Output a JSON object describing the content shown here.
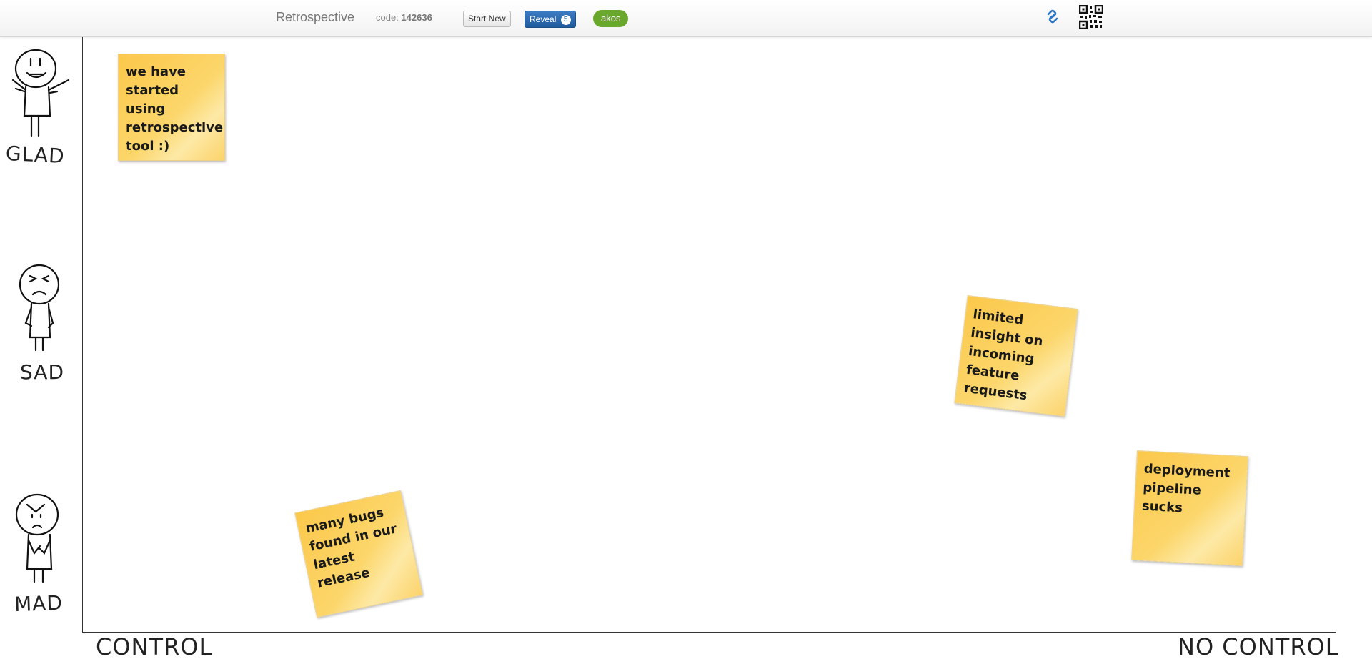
{
  "header": {
    "app_title": "Retrospective",
    "code_label": "code:",
    "code_value": "142636",
    "start_new_label": "Start New",
    "reveal_label": "Reveal",
    "reveal_count": "5",
    "user_name": "akos"
  },
  "board": {
    "emotions": [
      {
        "label": "GLAD"
      },
      {
        "label": "SAD"
      },
      {
        "label": "MAD"
      }
    ],
    "x_axis": {
      "left_label": "CONTROL",
      "right_label": "NO CONTROL"
    },
    "notes": [
      {
        "text": "we have started using retrospective tool :)"
      },
      {
        "text": "limited insight on incoming feature requests"
      },
      {
        "text": "deployment pipeline sucks"
      },
      {
        "text": "many bugs found in our latest release"
      }
    ]
  },
  "colors": {
    "reveal_button": "#2a67a8",
    "user_pill": "#6aa82d",
    "sticky_note": "#fcd36a"
  },
  "icons": {
    "link": "link-icon",
    "qr": "qr-code-icon"
  }
}
